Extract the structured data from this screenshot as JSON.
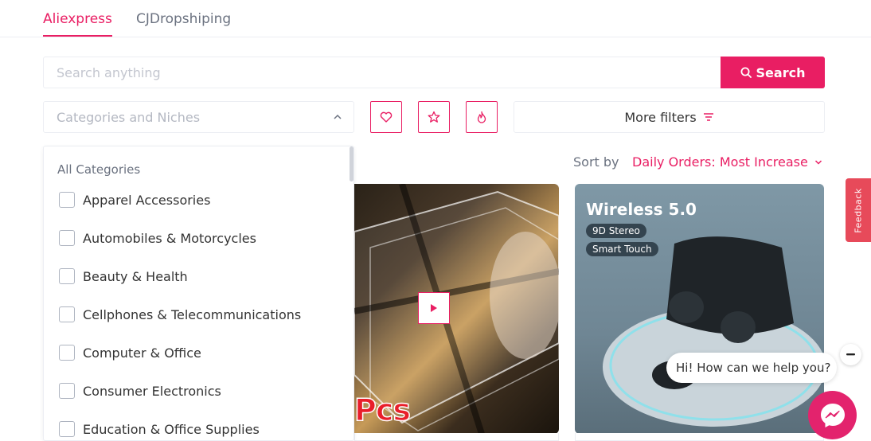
{
  "tabs": {
    "aliexpress": "Aliexpress",
    "cj": "CJDropshiping"
  },
  "search": {
    "placeholder": "Search anything",
    "button_label": "Search"
  },
  "filters": {
    "category_placeholder": "Categories and Niches",
    "more_filters_label": "More filters",
    "icon_buttons": [
      "heart-icon",
      "star-icon",
      "flame-icon"
    ]
  },
  "sort": {
    "label": "Sort by",
    "value": "Daily Orders: Most Increase"
  },
  "categories_dropdown": {
    "heading": "All Categories",
    "items": [
      "Apparel Accessories",
      "Automobiles & Motorcycles",
      "Beauty & Health",
      "Cellphones & Telecommunications",
      "Computer & Office",
      "Consumer Electronics",
      "Education & Office Supplies"
    ]
  },
  "products": [
    {
      "overlay_text": "Pcs",
      "has_video": true
    },
    {
      "title": "Wireless 5.0",
      "tags": [
        "9D Stereo",
        "Smart Touch"
      ]
    }
  ],
  "feedback_label": "Feedback",
  "chat": {
    "greeting": "Hi! How can we help you?"
  },
  "colors": {
    "accent": "#e91e63",
    "feedback": "#e74a5a",
    "messenger": "#e3236d"
  }
}
